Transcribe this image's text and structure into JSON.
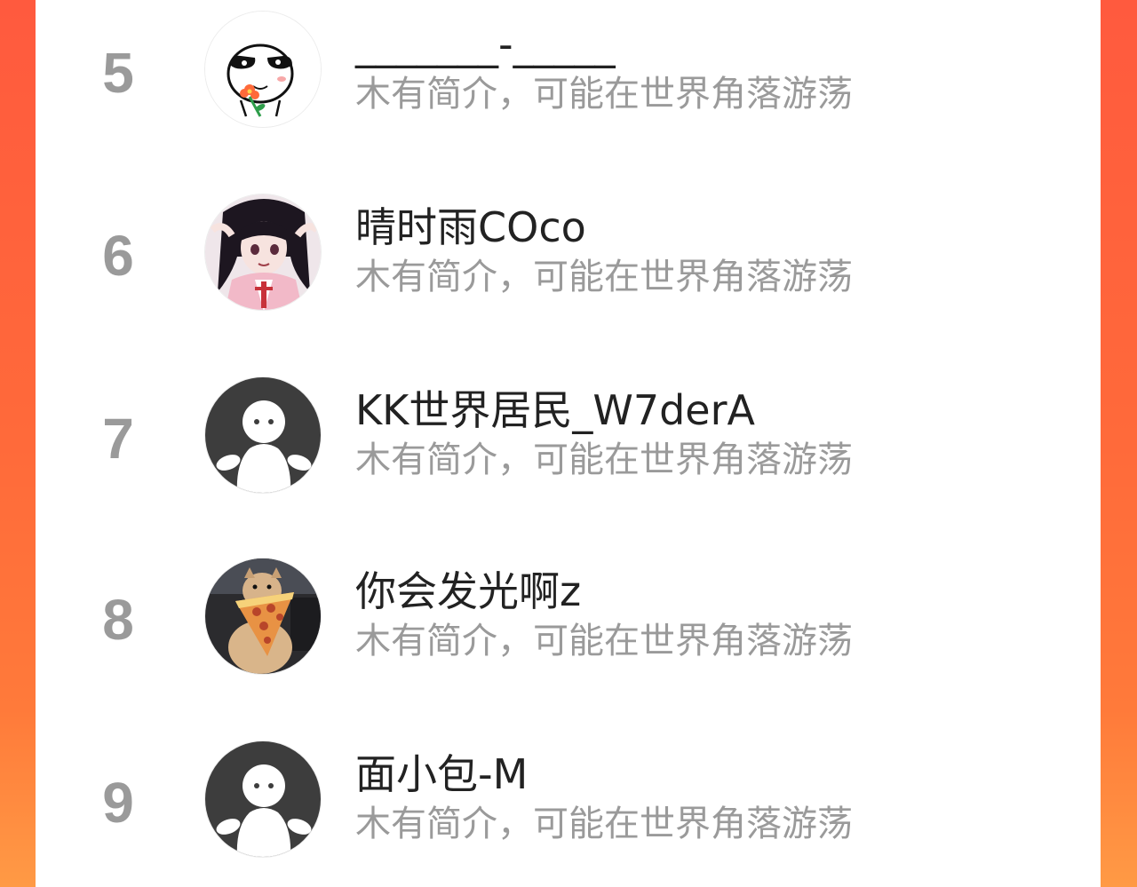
{
  "colors": {
    "panel": "#ffffff",
    "accent": "#ff5a3e",
    "rank": "#9a9a9a",
    "bio": "#9a9a9a",
    "name": "#222222"
  },
  "ranking": {
    "rows": [
      {
        "rank": "5",
        "name": "_______-_____",
        "bio": "木有简介，可能在世界角落游荡",
        "avatar": "meme-face-flower-avatar"
      },
      {
        "rank": "6",
        "name": "晴时雨COco",
        "bio": "木有简介，可能在世界角落游荡",
        "avatar": "anime-girl-avatar"
      },
      {
        "rank": "7",
        "name": "KK世界居民_W7derA",
        "bio": "木有简介，可能在世界角落游荡",
        "avatar": "default-user-avatar"
      },
      {
        "rank": "8",
        "name": "你会发光啊z",
        "bio": "木有简介，可能在世界角落游荡",
        "avatar": "dog-pizza-avatar"
      },
      {
        "rank": "9",
        "name": "面小包-M",
        "bio": "木有简介，可能在世界角落游荡",
        "avatar": "default-user-avatar"
      }
    ]
  }
}
